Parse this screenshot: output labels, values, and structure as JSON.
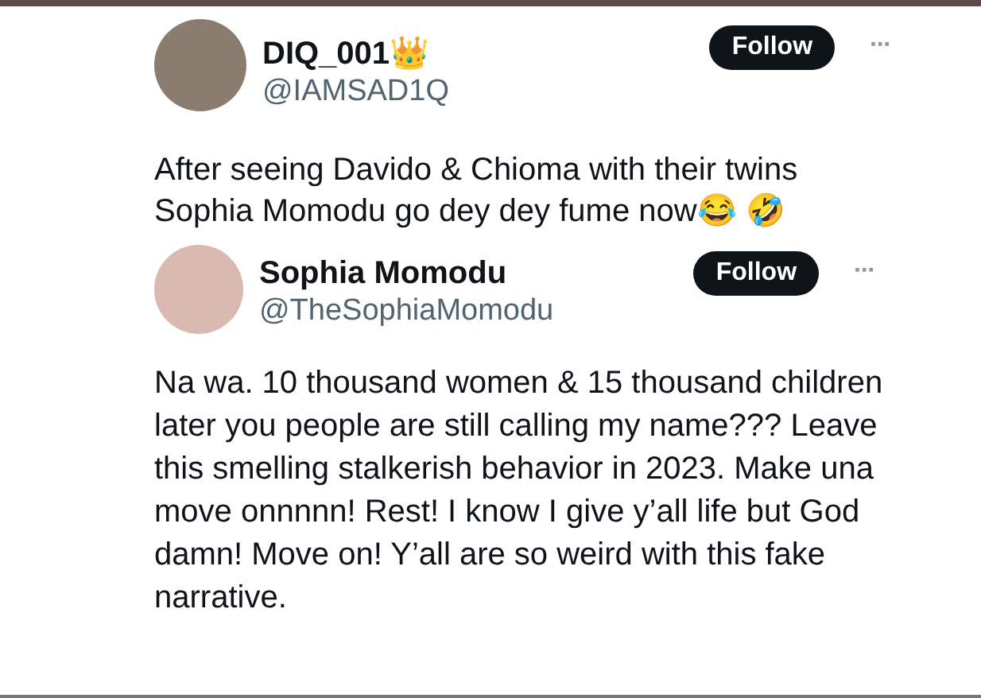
{
  "tweet": {
    "author": {
      "name": "DIQ_001👑",
      "handle": "@IAMSAD1Q",
      "follow": "Follow",
      "more": "···"
    },
    "text": "After seeing Davido & Chioma with their twins Sophia Momodu go dey dey fume now😂 🤣"
  },
  "quoted_tweet": {
    "author": {
      "name": "Sophia Momodu",
      "handle": "@TheSophiaMomodu",
      "follow": "Follow",
      "more": "···"
    },
    "text": "Na wa. 10 thousand women & 15 thousand children later you people are still calling my name??? Leave this smelling stalkerish behavior in 2023. Make una move onnnnn! Rest! I know I give y’all life but God damn! Move on! Y’all are so weird with this fake narrative."
  }
}
